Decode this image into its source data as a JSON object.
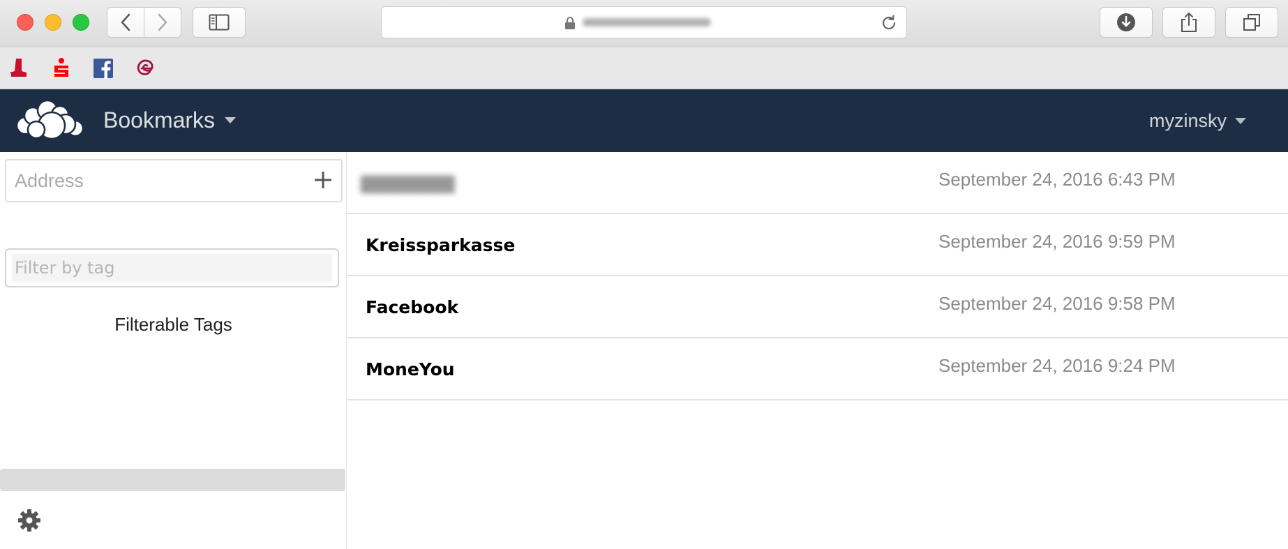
{
  "browser": {
    "url": "",
    "bookmarks_bar": [
      {
        "icon": "boot-icon",
        "color": "#c8102e"
      },
      {
        "icon": "sparkasse-icon",
        "color": "#ff0000"
      },
      {
        "icon": "facebook-icon",
        "color": "#3b5998"
      },
      {
        "icon": "moneyou-icon",
        "color": "#a4123f"
      }
    ]
  },
  "header": {
    "app_name": "Bookmarks",
    "user": "myzinsky",
    "bg_color": "#1d2d44"
  },
  "sidebar": {
    "address_placeholder": "Address",
    "filter_placeholder": "Filter by tag",
    "filterable_tags_label": "Filterable Tags"
  },
  "bookmarks": [
    {
      "title": "",
      "date": "September 24, 2016 6:43 PM",
      "blurred": true
    },
    {
      "title": "Kreissparkasse",
      "date": "September 24, 2016 9:59 PM"
    },
    {
      "title": "Facebook",
      "date": "September 24, 2016 9:58 PM"
    },
    {
      "title": "MoneYou",
      "date": "September 24, 2016 9:24 PM"
    }
  ]
}
